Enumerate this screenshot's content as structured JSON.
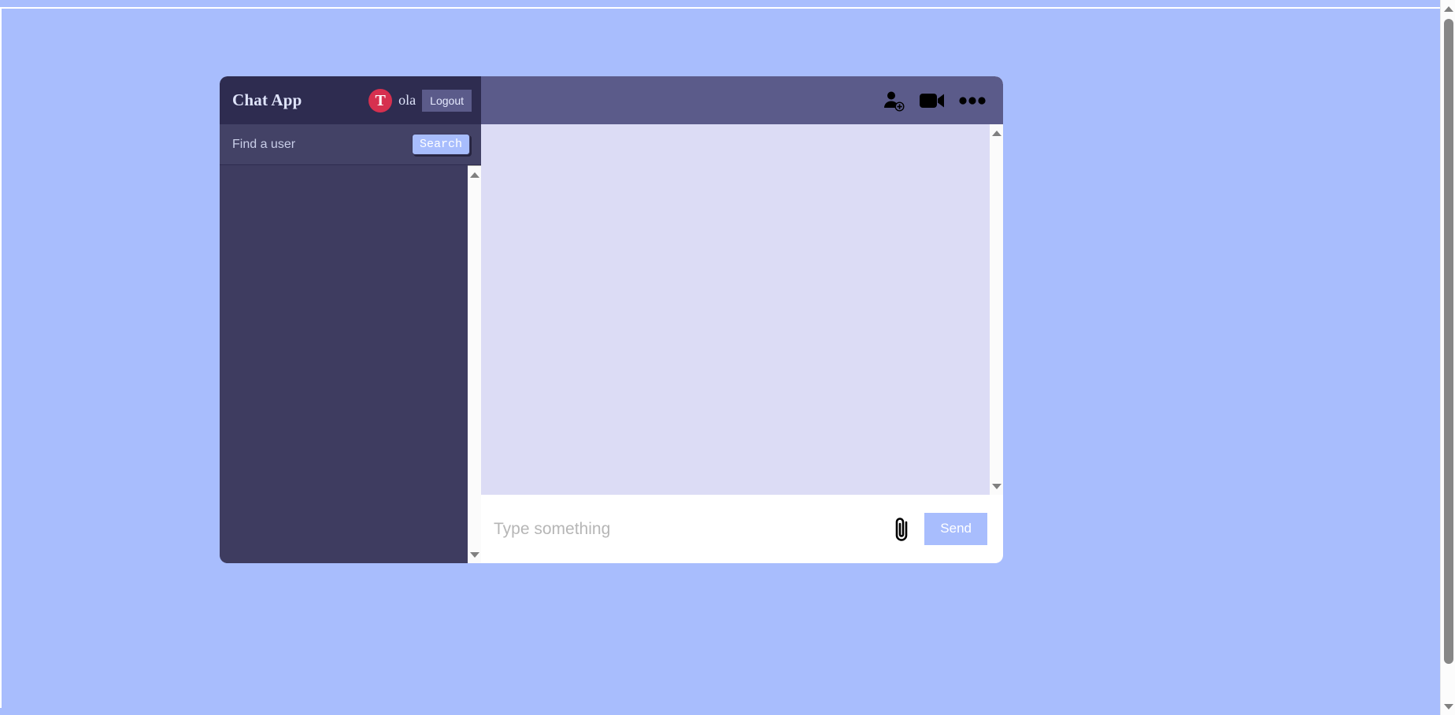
{
  "theme": {
    "page_background": "#a8bdfd",
    "navbar_background": "#2e2c50",
    "sidebar_background": "#3e3c60",
    "search_bar_background": "#434266",
    "chat_header_background": "#5b5b8a",
    "messages_background": "#dcdcf5",
    "accent": "#a8bdfd",
    "avatar_color": "#d6304f",
    "compose_background": "#ffffff"
  },
  "sidebar": {
    "navbar": {
      "brand": "Chat App",
      "user": {
        "avatar_initial": "T",
        "avatar_icon": "user-avatar",
        "name": "ola"
      },
      "logout_label": "Logout"
    },
    "search": {
      "placeholder": "Find a user",
      "value": "",
      "button_label": "Search"
    },
    "chats": [],
    "scrollbar": {
      "up_arrow_icon": "triangle-up-icon",
      "down_arrow_icon": "triangle-down-icon"
    }
  },
  "chat": {
    "header": {
      "icons": [
        {
          "name": "add-user-icon",
          "label": "Add user"
        },
        {
          "name": "video-camera-icon",
          "label": "Video call"
        },
        {
          "name": "more-options-icon",
          "label": "More"
        }
      ]
    },
    "messages": [],
    "scrollbar": {
      "up_arrow_icon": "triangle-up-icon",
      "down_arrow_icon": "triangle-down-icon"
    },
    "compose": {
      "placeholder": "Type something",
      "value": "",
      "attach_icon": "paperclip-icon",
      "send_label": "Send"
    }
  },
  "browser": {
    "scrollbar": {
      "up_arrow_icon": "triangle-up-icon",
      "down_arrow_icon": "triangle-down-icon"
    }
  }
}
